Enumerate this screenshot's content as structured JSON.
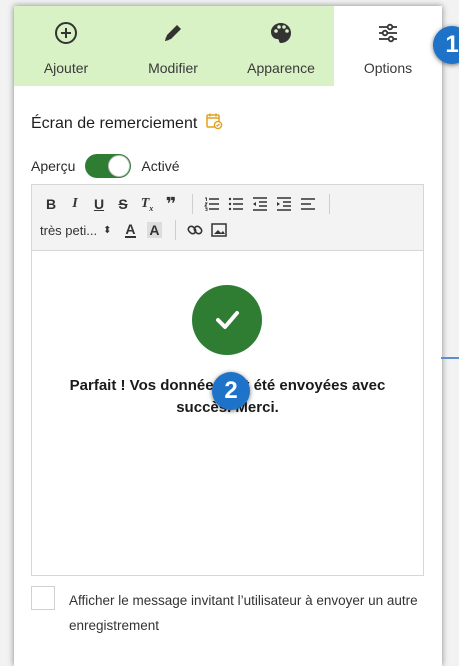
{
  "tabs": [
    {
      "label": "Ajouter",
      "icon": "plus-circle-icon"
    },
    {
      "label": "Modifier",
      "icon": "pencil-icon"
    },
    {
      "label": "Apparence",
      "icon": "palette-icon"
    },
    {
      "label": "Options",
      "icon": "sliders-icon",
      "active": true
    }
  ],
  "markers": [
    "1",
    "2"
  ],
  "section": {
    "title": "Écran de remerciement",
    "icon": "calendar-check-icon"
  },
  "preview": {
    "label": "Aperçu",
    "state_label": "Activé",
    "enabled": true
  },
  "toolbar": {
    "row1": [
      "bold-icon",
      "italic-icon",
      "underline-icon",
      "strikethrough-icon",
      "clear-format-icon",
      "quote-icon",
      "ordered-list-icon",
      "bullet-list-icon",
      "outdent-icon",
      "indent-icon",
      "align-icon"
    ],
    "font_size": "très peti...",
    "row2": [
      "font-color-icon",
      "highlight-icon",
      "link-icon",
      "image-icon"
    ]
  },
  "content": {
    "message": "Parfait ! Vos données ont été envoyées avec succès. Merci."
  },
  "option": {
    "label": "Afficher le message invitant l’utilisateur à envoyer un autre enregistrement",
    "checked": false
  },
  "colors": {
    "tab_bg": "#d8f1c5",
    "accent_green": "#2e7d32",
    "marker_blue": "#1e73c8"
  }
}
